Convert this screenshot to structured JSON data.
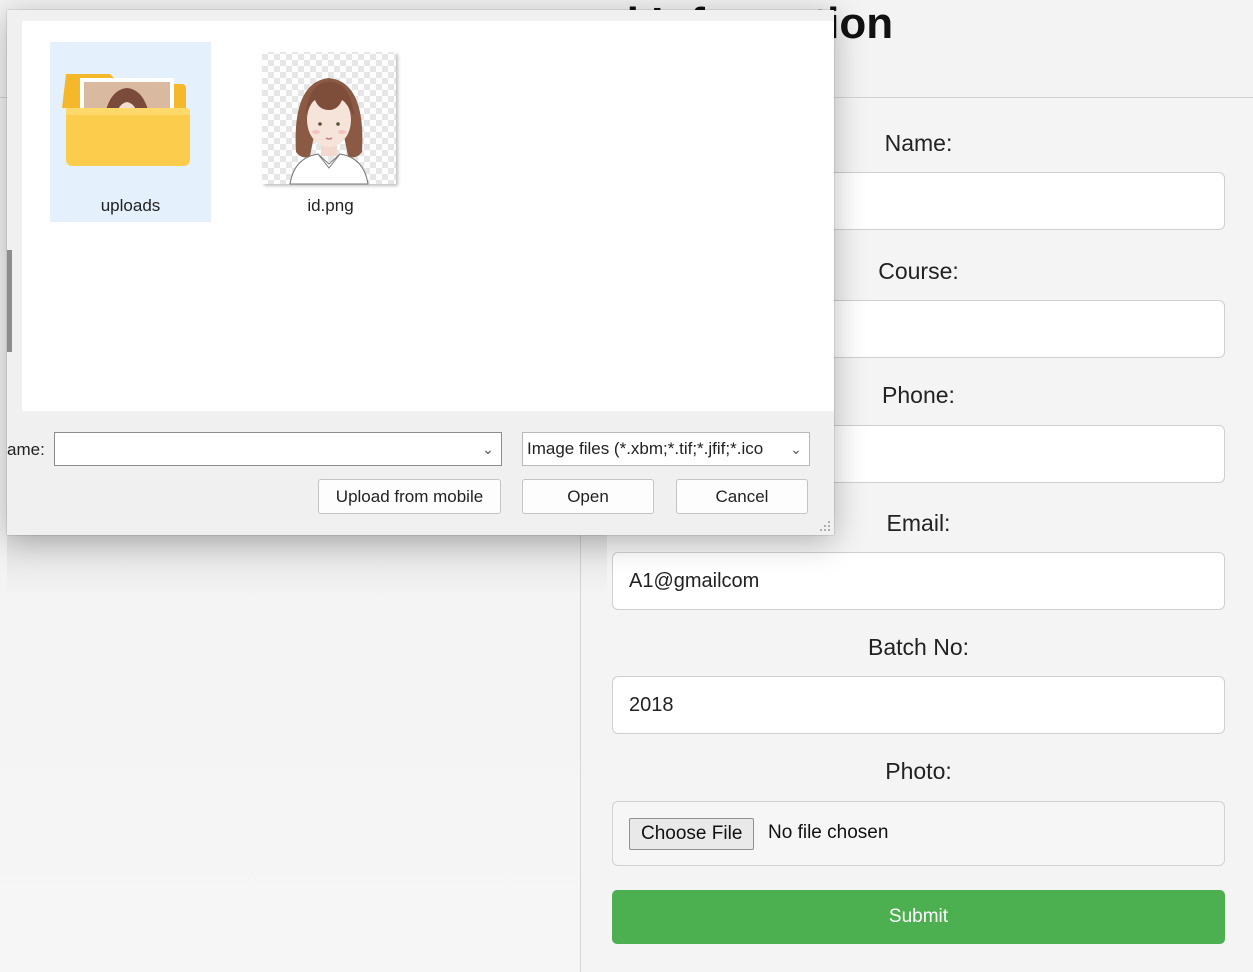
{
  "page": {
    "title": "d Information"
  },
  "form": {
    "fields": [
      {
        "label": "Name:",
        "value": ""
      },
      {
        "label": "Course:",
        "value": ""
      },
      {
        "label": "Phone:",
        "value": ""
      },
      {
        "label": "Email:",
        "value": "A1@gmailcom"
      },
      {
        "label": "Batch No:",
        "value": "2018"
      }
    ],
    "photo_label": "Photo:",
    "choose_file_label": "Choose File",
    "no_file_text": "No file chosen",
    "submit_label": "Submit",
    "submit_color": "#4caf50"
  },
  "dialog": {
    "items": [
      {
        "name": "uploads",
        "type": "folder",
        "icon": "folder-icon"
      },
      {
        "name": "id.png",
        "type": "image",
        "icon": "image-thumbnail-icon"
      }
    ],
    "filename_label": "ame:",
    "filename_value": "",
    "filetype_value": "Image files (*.xbm;*.tif;*.jfif;*.ico",
    "upload_mobile_label": "Upload from mobile",
    "open_label": "Open",
    "cancel_label": "Cancel"
  }
}
